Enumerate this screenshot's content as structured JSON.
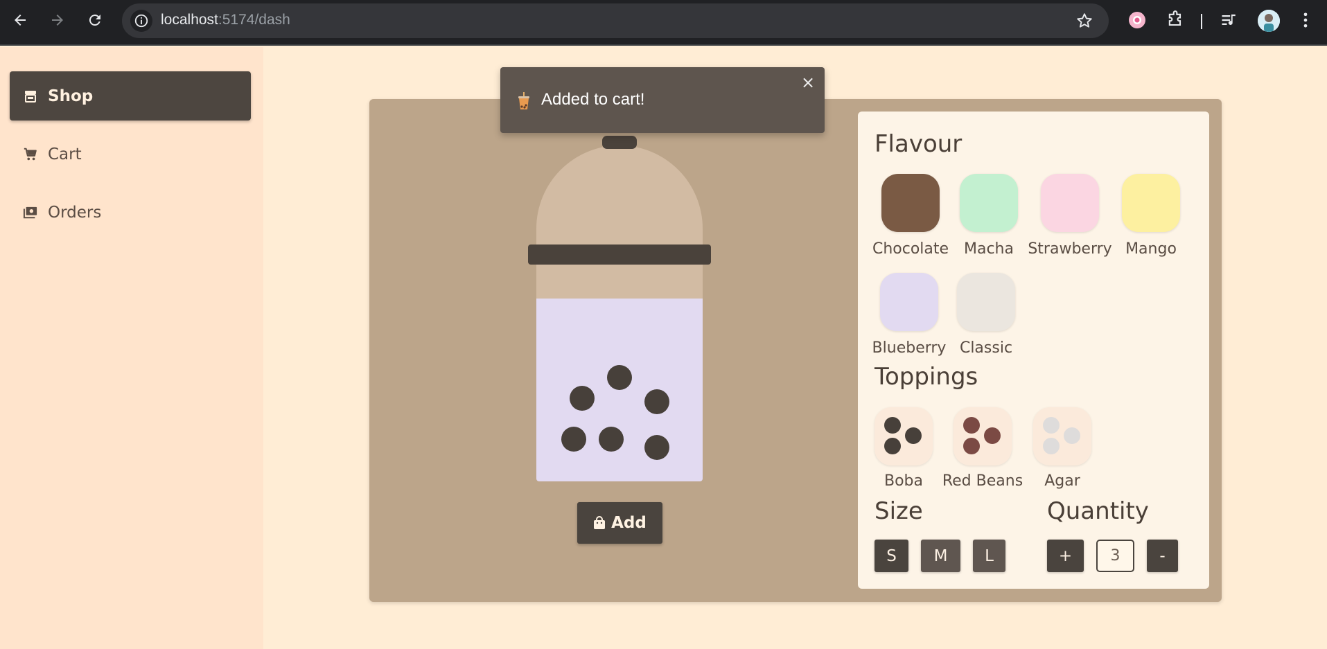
{
  "browser": {
    "url_host": "localhost",
    "url_path": ":5174/dash"
  },
  "sidebar": {
    "items": [
      {
        "label": "Shop",
        "icon": "store-icon",
        "active": true
      },
      {
        "label": "Cart",
        "icon": "cart-icon",
        "active": false
      },
      {
        "label": "Orders",
        "icon": "orders-icon",
        "active": false
      }
    ]
  },
  "toast": {
    "message": "Added to cart!",
    "icon": "bubble-tea-icon"
  },
  "preview": {
    "add_label": "Add",
    "drink_color": "#e2daf1"
  },
  "options": {
    "flavour_title": "Flavour",
    "flavours": [
      {
        "label": "Chocolate",
        "color": "#7a5a44"
      },
      {
        "label": "Macha",
        "color": "#c3f0d0"
      },
      {
        "label": "Strawberry",
        "color": "#fbd6e2"
      },
      {
        "label": "Mango",
        "color": "#fdf0a0"
      },
      {
        "label": "Blueberry",
        "color": "#e2daf1"
      },
      {
        "label": "Classic",
        "color": "#ebe6df"
      }
    ],
    "toppings_title": "Toppings",
    "toppings": [
      {
        "label": "Boba",
        "color": "#47403a"
      },
      {
        "label": "Red Beans",
        "color": "#7b4a44"
      },
      {
        "label": "Agar",
        "color": "#dedcdb"
      }
    ],
    "size_title": "Size",
    "sizes": [
      "S",
      "M",
      "L"
    ],
    "selected_size": "S",
    "quantity_title": "Quantity",
    "plus_label": "+",
    "minus_label": "-",
    "quantity": "3"
  }
}
